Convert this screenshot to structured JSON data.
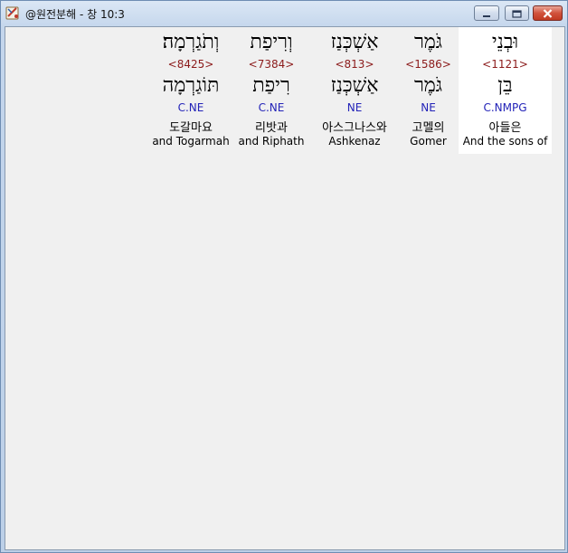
{
  "window": {
    "title": "@원전분해 - 창 10:3",
    "app_icon": "bible-app-icon",
    "buttons": {
      "minimize": "minimize-icon",
      "maximize": "maximize-icon",
      "close": "close-icon"
    },
    "close_color": "#c8452e"
  },
  "colors": {
    "strong_number": "#8b1a1a",
    "morphology": "#2323b8",
    "selected_background": "#ffffff",
    "pane_background": "#f0f0f0"
  },
  "words": [
    {
      "hebrew": "וּבְנֵי",
      "strong": "<1121>",
      "root": "בֵּן",
      "morph": "C.NMPG",
      "korean": "아들은",
      "english": "And the sons of",
      "selected": true
    },
    {
      "hebrew": "גֹּמֶר",
      "strong": "<1586>",
      "root": "גֹּמֶר",
      "morph": "NE",
      "korean": "고멜의",
      "english": "Gomer",
      "selected": false
    },
    {
      "hebrew": "אַשְׁכְּנַז",
      "strong": "<813>",
      "root": "אַשְׁכְּנַז",
      "morph": "NE",
      "korean": "아스그나스와",
      "english": "Ashkenaz",
      "selected": false
    },
    {
      "hebrew": "וְרִיפַת",
      "strong": "<7384>",
      "root": "רִיפַת",
      "morph": "C.NE",
      "korean": "리밧과",
      "english": "and Riphath",
      "selected": false
    },
    {
      "hebrew": "וְתֹגַרְמָה׃",
      "strong": "<8425>",
      "root": "תּוֹגַרְמָה",
      "morph": "C.NE",
      "korean": "도갈마요",
      "english": "and Togarmah",
      "selected": false
    }
  ]
}
